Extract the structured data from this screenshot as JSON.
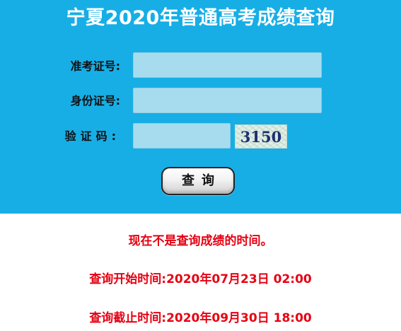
{
  "header": {
    "title": "宁夏2020年普通高考成绩查询"
  },
  "form": {
    "exam_number_label": "准考证号:",
    "exam_number_value": "",
    "id_number_label": "身份证号:",
    "id_number_value": "",
    "captcha_label": "验证码:",
    "captcha_value": "",
    "captcha_image_text": "3150",
    "query_button_label": "查询"
  },
  "notice": {
    "message": "现在不是查询成绩的时间。",
    "start_time": "查询开始时间:2020年07月23日 02:00",
    "end_time": "查询截止时间:2020年09月30日 18:00"
  },
  "colors": {
    "panel_background": "#17aee6",
    "input_background": "#a7dcef",
    "notice_text": "#e60012",
    "title_text": "#ffffff"
  }
}
